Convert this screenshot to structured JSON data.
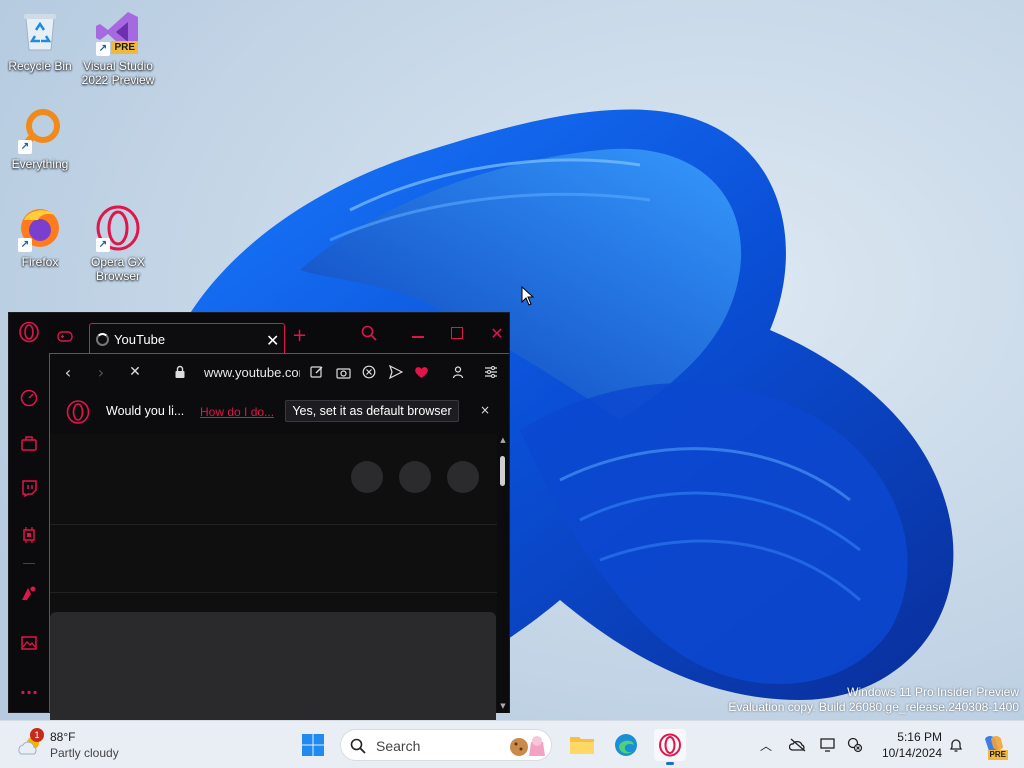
{
  "desktop": {
    "icons": [
      {
        "label": "Recycle Bin",
        "icon": "recycle-bin-icon"
      },
      {
        "label": "Visual Studio 2022 Preview",
        "icon": "visual-studio-icon",
        "badge": "PRE"
      },
      {
        "label": "Everything",
        "icon": "everything-search-icon"
      },
      {
        "label": "Firefox",
        "icon": "firefox-icon"
      },
      {
        "label": "Opera GX Browser",
        "icon": "opera-gx-icon"
      }
    ],
    "watermark_line1": "Windows 11 Pro Insider Preview",
    "watermark_line2": "Evaluation copy. Build 26080.ge_release.240308-1400"
  },
  "browser": {
    "tab_title": "YouTube",
    "url": "www.youtube.com",
    "infobar": {
      "question": "Would you li...",
      "link": "How do I do...",
      "button": "Yes, set it as default browser",
      "close": "×"
    },
    "colors": {
      "accent": "#e0154a",
      "background": "#0a0a0c"
    }
  },
  "taskbar": {
    "weather_temp": "88°F",
    "weather_desc": "Partly cloudy",
    "weather_badge": "1",
    "search_placeholder": "Search",
    "time": "5:16 PM",
    "date": "10/14/2024",
    "copilot_badge": "PRE"
  }
}
